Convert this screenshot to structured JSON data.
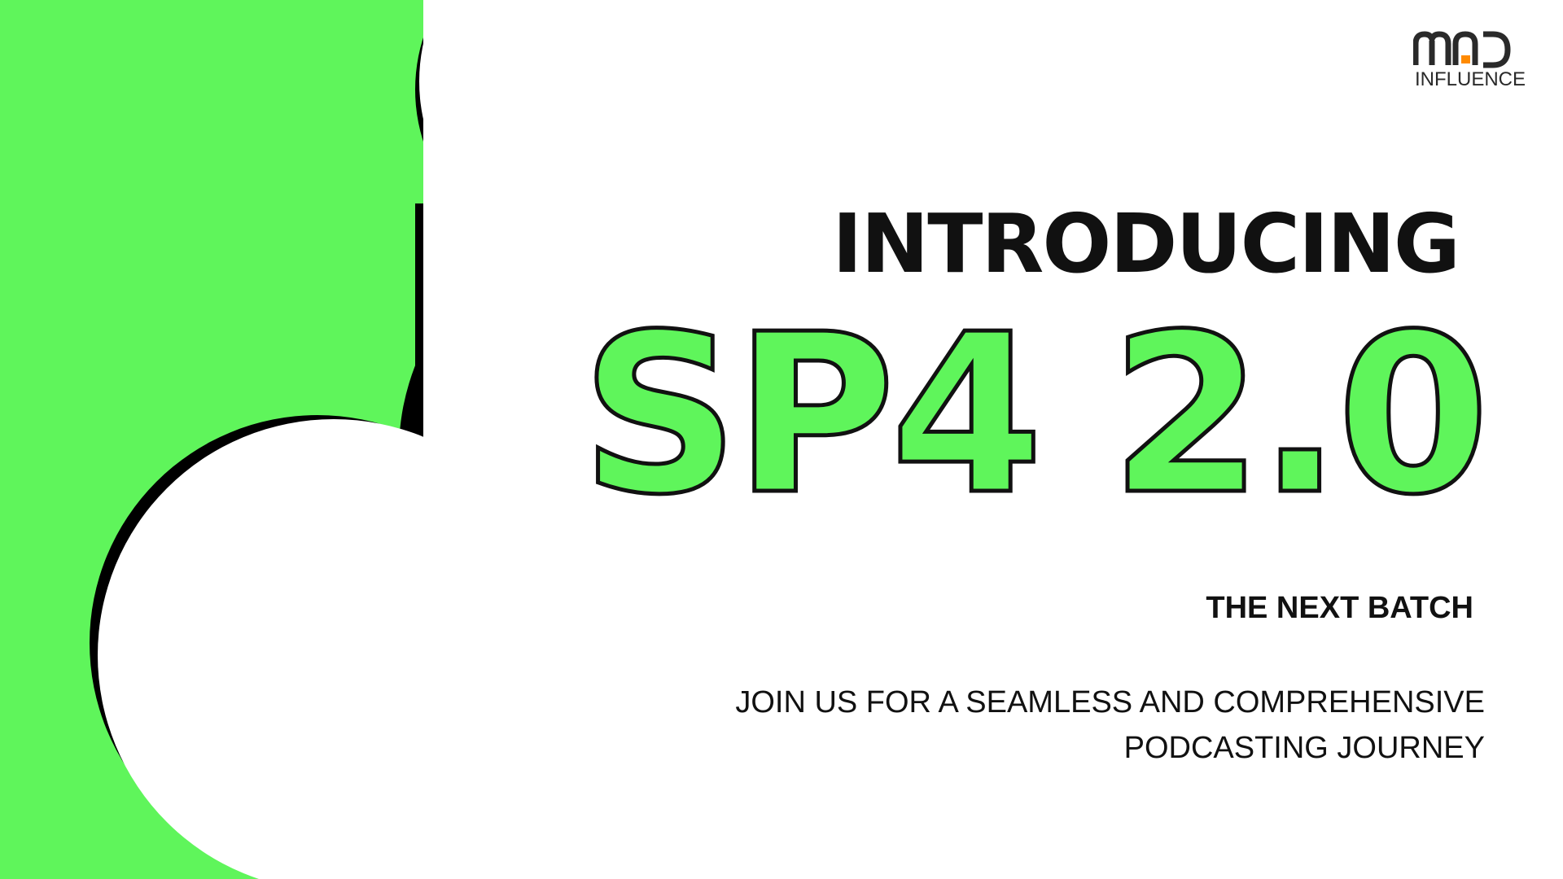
{
  "brand": {
    "logo_mark": "MAD",
    "logo_text": "INFLUENCE",
    "accent": "#ff8a00"
  },
  "hero": {
    "headline": "INTRODUCING",
    "title": "SP4 2.0",
    "subhead": "THE NEXT BATCH",
    "tagline_line1": "JOIN US FOR A SEAMLESS AND COMPREHENSIVE",
    "tagline_line2": "PODCASTING JOURNEY"
  },
  "colors": {
    "green": "#5ff55b",
    "black": "#111111",
    "white": "#ffffff"
  }
}
